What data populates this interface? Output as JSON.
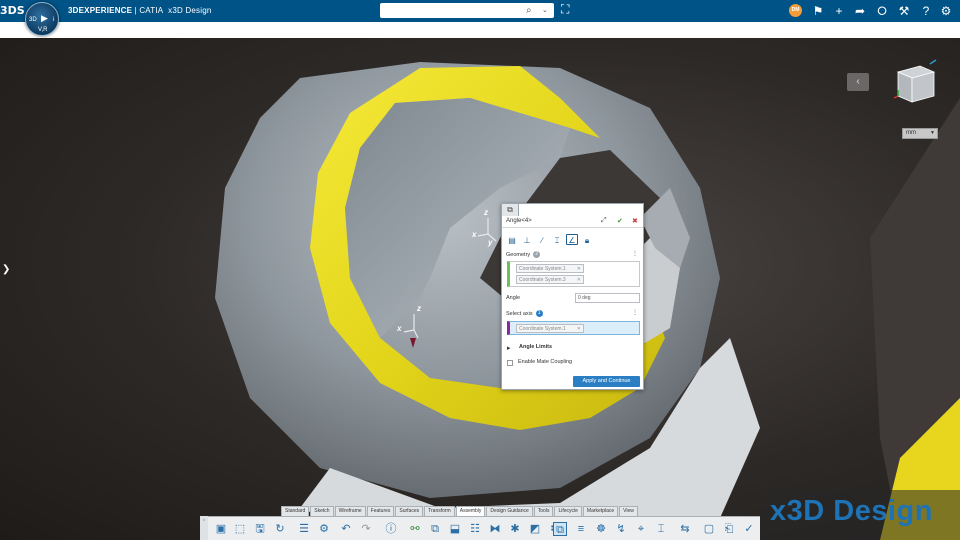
{
  "app": {
    "brand": "3DS",
    "title_bold": "3DEXPERIENCE",
    "title_sep": " | ",
    "title_product": "CATIA",
    "title_module": "x3D Design",
    "compass_labels": {
      "left": "3D",
      "right": "i",
      "bottom": "V,R"
    }
  },
  "search": {
    "value": "",
    "placeholder": ""
  },
  "user": {
    "initials": "DM"
  },
  "topbar_icons": [
    "tag-icon",
    "bookmark-icon",
    "plus-icon",
    "share-arrow-icon",
    "share-network-icon",
    "tools-icon",
    "help-icon",
    "account-icon"
  ],
  "viewport": {
    "units": "mm",
    "axes": [
      {
        "x": "x",
        "y": "y",
        "z": "z"
      },
      {
        "x": "x",
        "y": "",
        "z": "z"
      }
    ]
  },
  "panel": {
    "title": "Angle<4>",
    "tool_icons": [
      "fix-icon",
      "perpendicular-icon",
      "parallel-icon",
      "distance-icon",
      "angle-icon",
      "lock-icon"
    ],
    "geometry_label": "Geometry",
    "geometry_count": "2",
    "geometry_items": [
      "Coordinate System.1",
      "Coordinate System.3"
    ],
    "angle_label": "Angle",
    "angle_value": "0 deg",
    "select_axis_label": "Select axis",
    "select_axis_count": "1",
    "axis_items": [
      "Coordinate System.1"
    ],
    "angle_limits_label": "Angle Limits",
    "mate_coupling_label": "Enable Mate Coupling",
    "apply_label": "Apply and Continue"
  },
  "bottom_tabs": [
    "Standard",
    "Sketch",
    "Wireframe",
    "Features",
    "Surfaces",
    "Transform",
    "Assembly",
    "Design Guidance",
    "Tools",
    "Lifecycle",
    "Marketplace",
    "View"
  ],
  "active_tab": "Assembly",
  "watermark": "x3D Design",
  "colors": {
    "topbar": "#005386",
    "part_yellow": "#e8dc20",
    "part_gray": "#9aa3ab",
    "accent": "#2a7fc4"
  }
}
